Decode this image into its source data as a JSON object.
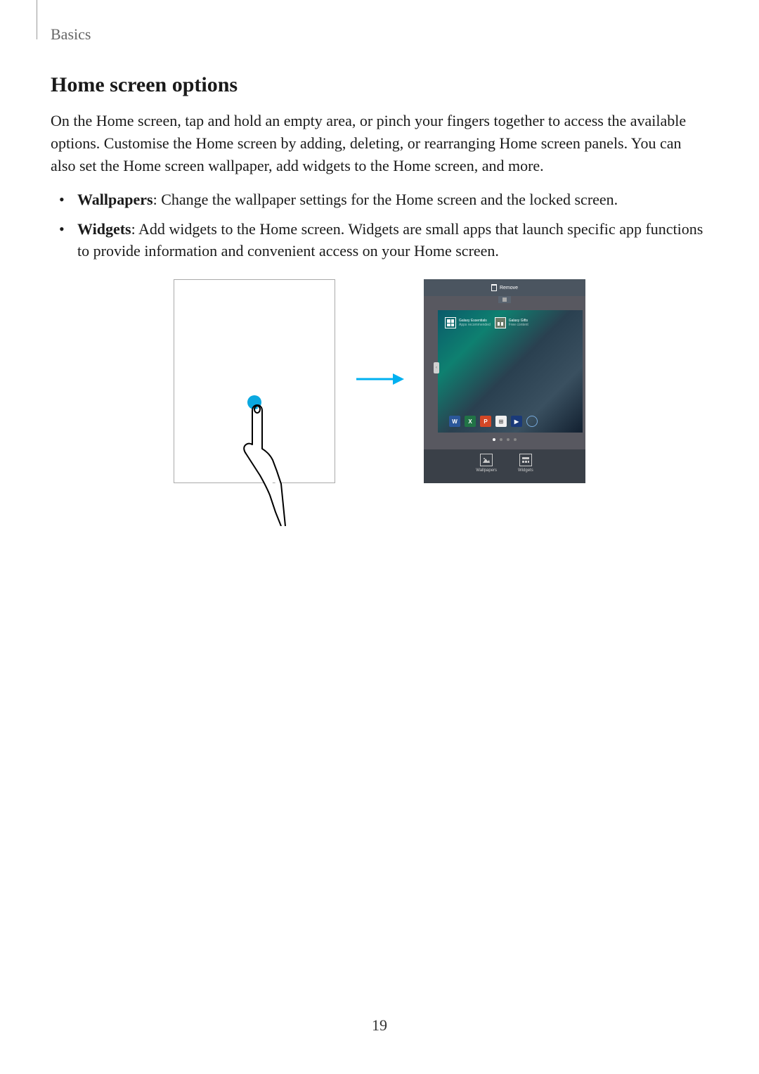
{
  "breadcrumb": "Basics",
  "section_title": "Home screen options",
  "intro_paragraph": "On the Home screen, tap and hold an empty area, or pinch your fingers together to access the available options. Customise the Home screen by adding, deleting, or rearranging Home screen panels. You can also set the Home screen wallpaper, add widgets to the Home screen, and more.",
  "bullets": [
    {
      "term": "Wallpapers",
      "desc": ": Change the wallpaper settings for the Home screen and the locked screen."
    },
    {
      "term": "Widgets",
      "desc": ": Add widgets to the Home screen. Widgets are small apps that launch specific app functions to provide information and convenient access on your Home screen."
    }
  ],
  "screenshot": {
    "remove_label": "Remove",
    "widget1_title": "Galaxy Essentials",
    "widget1_sub": "Apps recommended",
    "widget2_title": "Galaxy Gifts",
    "widget2_sub": "Free content",
    "wallpapers_label": "Wallpapers",
    "widgets_label": "Widgets",
    "side_tab": "‹"
  },
  "page_number": "19",
  "colors": {
    "arrow": "#00b0f0",
    "touch": "#0aa8e0"
  }
}
